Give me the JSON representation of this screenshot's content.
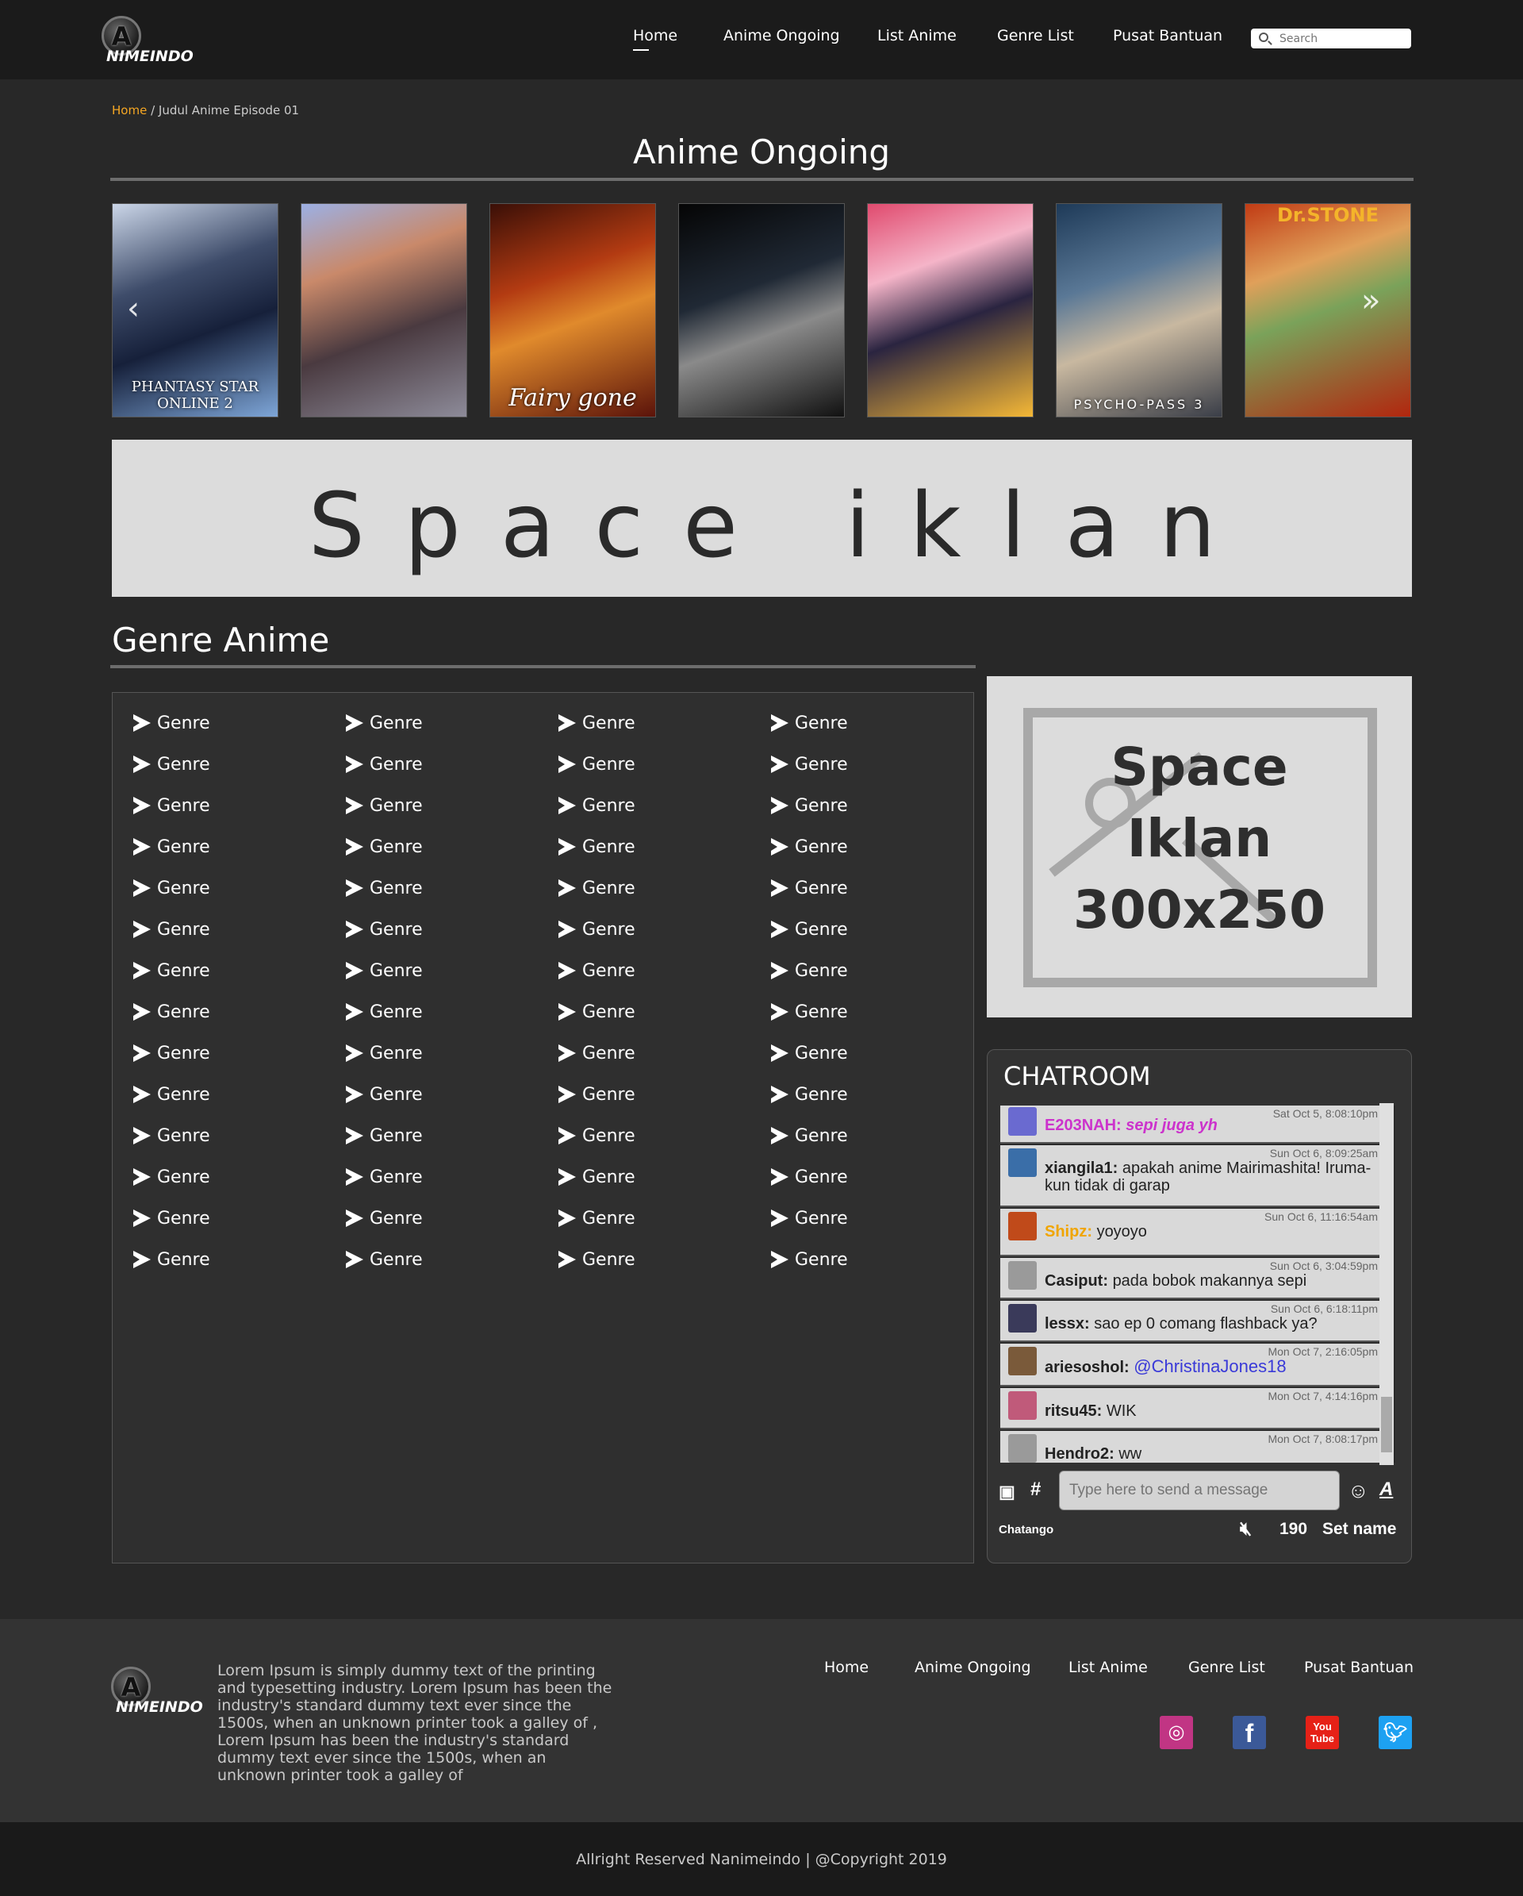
{
  "header": {
    "logo_letter": "A",
    "logo_word": "NIMEINDO",
    "nav": [
      "Home",
      "Anime Ongoing",
      "List Anime",
      "Genre List",
      "Pusat Bantuan"
    ],
    "active_nav": "Home",
    "search_placeholder": "Search"
  },
  "breadcrumb": {
    "home": "Home",
    "current": "/ Judul Anime Episode 01"
  },
  "ongoing": {
    "title": "Anime Ongoing",
    "posters": [
      {
        "caption": "PHANTASY STAR ONLINE 2"
      },
      {
        "caption": ""
      },
      {
        "caption": "Fairy gone"
      },
      {
        "caption": ""
      },
      {
        "caption": ""
      },
      {
        "caption": "PSYCHO-PASS 3"
      },
      {
        "caption": "Dr.STONE"
      }
    ],
    "prev_icon": "chevron-left-icon",
    "next_icon": "chevron-right-icon"
  },
  "ad_banner": {
    "text": "Space iklan"
  },
  "genre": {
    "title": "Genre Anime",
    "item_label": "Genre",
    "columns": 4,
    "rows": 14
  },
  "side_ad": {
    "line1": "Space",
    "line2": "Iklan",
    "line3": "300x250"
  },
  "chatroom": {
    "title": "CHATROOM",
    "messages": [
      {
        "time": "Sat Oct 5, 8:08:10pm",
        "name": "E203NAH:",
        "text": "sepi juga yh",
        "color": "#cc33cc"
      },
      {
        "time": "Sun Oct 6, 8:09:25am",
        "name": "xiangila1:",
        "text": "apakah anime Mairimashita! Iruma-kun tidak di garap",
        "color": "#222222"
      },
      {
        "time": "Sun Oct 6, 11:16:54am",
        "name": "Shipz:",
        "text": "yoyoyo",
        "color": "#f0a500"
      },
      {
        "time": "Sun Oct 6, 3:04:59pm",
        "name": "Casiput:",
        "text": "pada bobok makannya sepi",
        "color": "#222222"
      },
      {
        "time": "Sun Oct 6, 6:18:11pm",
        "name": "lessx:",
        "text": "sao ep 0 comang flashback ya?",
        "color": "#222222"
      },
      {
        "time": "Mon Oct 7, 2:16:05pm",
        "name": "ariesoshol:",
        "text": "@ChristinaJones18",
        "color": "#222222"
      },
      {
        "time": "Mon Oct 7, 4:14:16pm",
        "name": "ritsu45:",
        "text": "WIK",
        "color": "#222222"
      },
      {
        "time": "Mon Oct 7, 8:08:17pm",
        "name": "Hendro2:",
        "text": "ww",
        "color": "#222222"
      }
    ],
    "input_placeholder": "Type here to send a message",
    "brand": "Chatango",
    "count": "190",
    "set_name": "Set name",
    "hash": "#"
  },
  "footer": {
    "description": "Lorem Ipsum is simply dummy text of the printing and typesetting industry. Lorem Ipsum has been the industry's standard dummy text ever since the 1500s, when an unknown printer took a galley of , Lorem Ipsum has been the industry's standard dummy text ever since the 1500s, when an unknown printer took a galley of",
    "nav": [
      "Home",
      "Anime Ongoing",
      "List Anime",
      "Genre List",
      "Pusat Bantuan"
    ],
    "social": [
      {
        "icon": "instagram-icon",
        "color": "#c13584"
      },
      {
        "icon": "facebook-icon",
        "color": "#3b5998"
      },
      {
        "icon": "youtube-icon",
        "color": "#e62117"
      },
      {
        "icon": "twitter-icon",
        "color": "#1da1f2"
      }
    ],
    "copyright": "Allright Reserved Nanimeindo | @Copyright 2019"
  }
}
